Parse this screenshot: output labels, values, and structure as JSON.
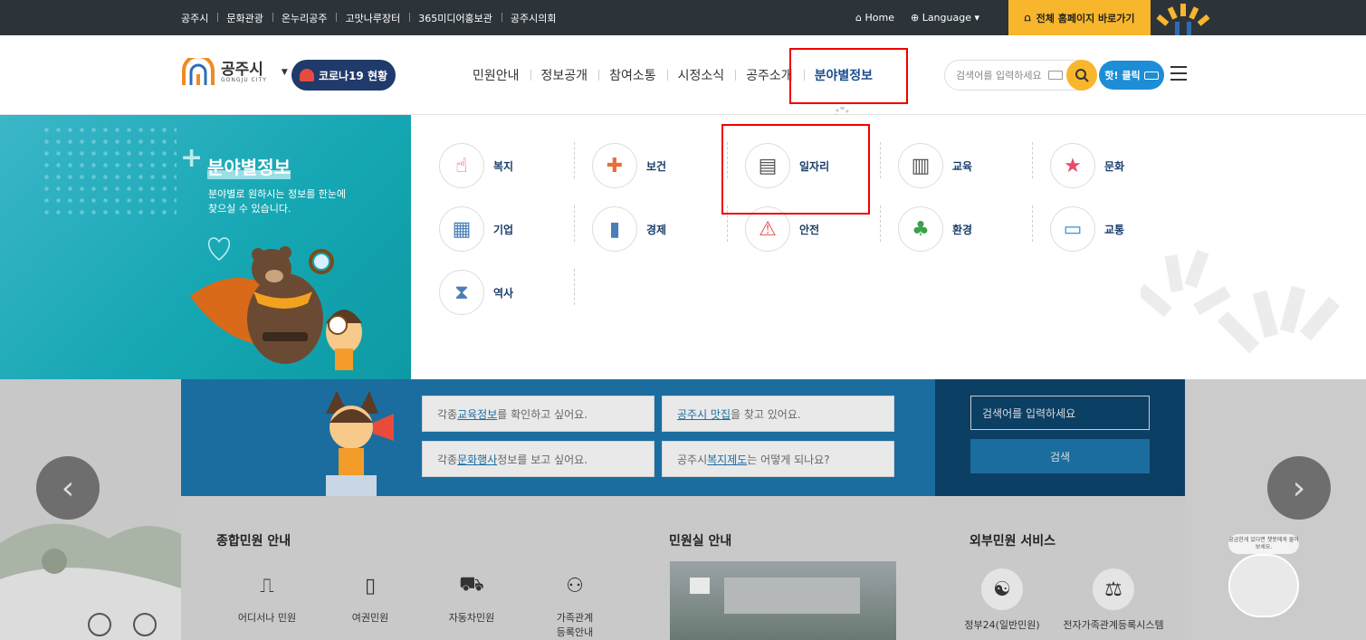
{
  "topbar": {
    "links": [
      "공주시",
      "문화관광",
      "온누리공주",
      "고맛나루장터",
      "365미디어홍보관",
      "공주시의회"
    ],
    "home": "Home",
    "language": "Language",
    "full_site": "전체 홈페이지 바로가기"
  },
  "header": {
    "logo_ko": "공주시",
    "logo_en": "GONGJU CITY",
    "covid": "코로나19 현황",
    "gnb": [
      "민원안내",
      "정보공개",
      "참여소통",
      "시정소식",
      "공주소개",
      "분야별정보"
    ],
    "active_gnb": "분야별정보",
    "search_placeholder": "검색어를 입력하세요",
    "hot_click": "핫! 클릭"
  },
  "mega_menu": {
    "title": "분야별정보",
    "desc": "분야별로 원하시는 정보를 한눈에 찾으실 수 있습니다.",
    "items": [
      {
        "label": "복지",
        "icon": "welfare-icon",
        "glyph": "☝"
      },
      {
        "label": "보건",
        "icon": "health-icon",
        "glyph": "✚"
      },
      {
        "label": "일자리",
        "icon": "jobs-icon",
        "glyph": "▤"
      },
      {
        "label": "교육",
        "icon": "education-icon",
        "glyph": "▥"
      },
      {
        "label": "문화",
        "icon": "culture-icon",
        "glyph": "★"
      },
      {
        "label": "기업",
        "icon": "company-icon",
        "glyph": "▦"
      },
      {
        "label": "경제",
        "icon": "economy-icon",
        "glyph": "▮"
      },
      {
        "label": "안전",
        "icon": "safety-icon",
        "glyph": "⚠"
      },
      {
        "label": "환경",
        "icon": "environment-icon",
        "glyph": "♣"
      },
      {
        "label": "교통",
        "icon": "transport-icon",
        "glyph": "▭"
      },
      {
        "label": "역사",
        "icon": "history-icon",
        "glyph": "⧗"
      }
    ]
  },
  "quick_questions": [
    {
      "pre": "각종 ",
      "link": "교육정보",
      "post": "를 확인하고 싶어요."
    },
    {
      "pre": "",
      "link": "공주시 맛집",
      "post": "을 찾고 있어요."
    },
    {
      "pre": "각종 ",
      "link": "문화행사",
      "post": " 정보를 보고 싶어요."
    },
    {
      "pre": "공주시 ",
      "link": "복지제도",
      "post": "는 어떻게 되나요?"
    }
  ],
  "side_search": {
    "placeholder": "검색어를 입력하세요",
    "button": "검색"
  },
  "sections": {
    "civil": {
      "title": "종합민원 안내",
      "items": [
        "어디서나 민원",
        "여권민원",
        "자동차민원",
        "가족관계\n등록안내"
      ]
    },
    "office": {
      "title": "민원실 안내"
    },
    "external": {
      "title": "외부민원 서비스",
      "items": [
        "정부24(일반민원)",
        "전자가족관계등록시스템"
      ]
    }
  },
  "badge_text": "궁금한게 있다면 챗봇에게 물어보세요."
}
